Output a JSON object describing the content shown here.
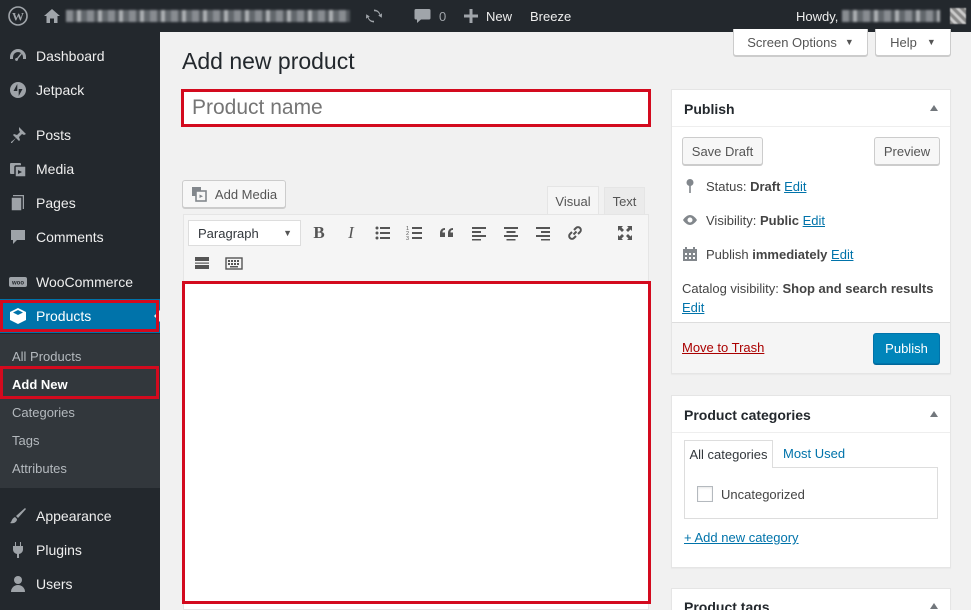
{
  "adminbar": {
    "comments_count": "0",
    "new_label": "New",
    "breeze_label": "Breeze",
    "howdy_label": "Howdy,"
  },
  "sidebar": {
    "dashboard": "Dashboard",
    "jetpack": "Jetpack",
    "posts": "Posts",
    "media": "Media",
    "pages": "Pages",
    "comments": "Comments",
    "woocommerce": "WooCommerce",
    "products": "Products",
    "submenu": [
      "All Products",
      "Add New",
      "Categories",
      "Tags",
      "Attributes"
    ],
    "appearance": "Appearance",
    "plugins": "Plugins",
    "users": "Users"
  },
  "header": {
    "screen_options": "Screen Options",
    "help": "Help",
    "page_title": "Add new product"
  },
  "editor": {
    "title_placeholder": "Product name",
    "add_media": "Add Media",
    "tab_visual": "Visual",
    "tab_text": "Text",
    "format_select": "Paragraph"
  },
  "publish": {
    "title": "Publish",
    "save_draft": "Save Draft",
    "preview": "Preview",
    "status_label": "Status:",
    "status_value": "Draft",
    "visibility_label": "Visibility:",
    "visibility_value": "Public",
    "publish_label": "Publish",
    "publish_value": "immediately",
    "edit": "Edit",
    "catalog_label": "Catalog visibility:",
    "catalog_value": "Shop and search results",
    "move_to_trash": "Move to Trash",
    "publish_button": "Publish"
  },
  "categories": {
    "title": "Product categories",
    "tab_all": "All categories",
    "tab_most_used": "Most Used",
    "items": [
      "Uncategorized"
    ],
    "add_new": "+ Add new category"
  },
  "tags": {
    "title": "Product tags"
  },
  "colors": {
    "accent": "#0073aa",
    "highlight": "#d30a1e",
    "admin_dark": "#23282d",
    "active_menu": "#0073aa"
  }
}
